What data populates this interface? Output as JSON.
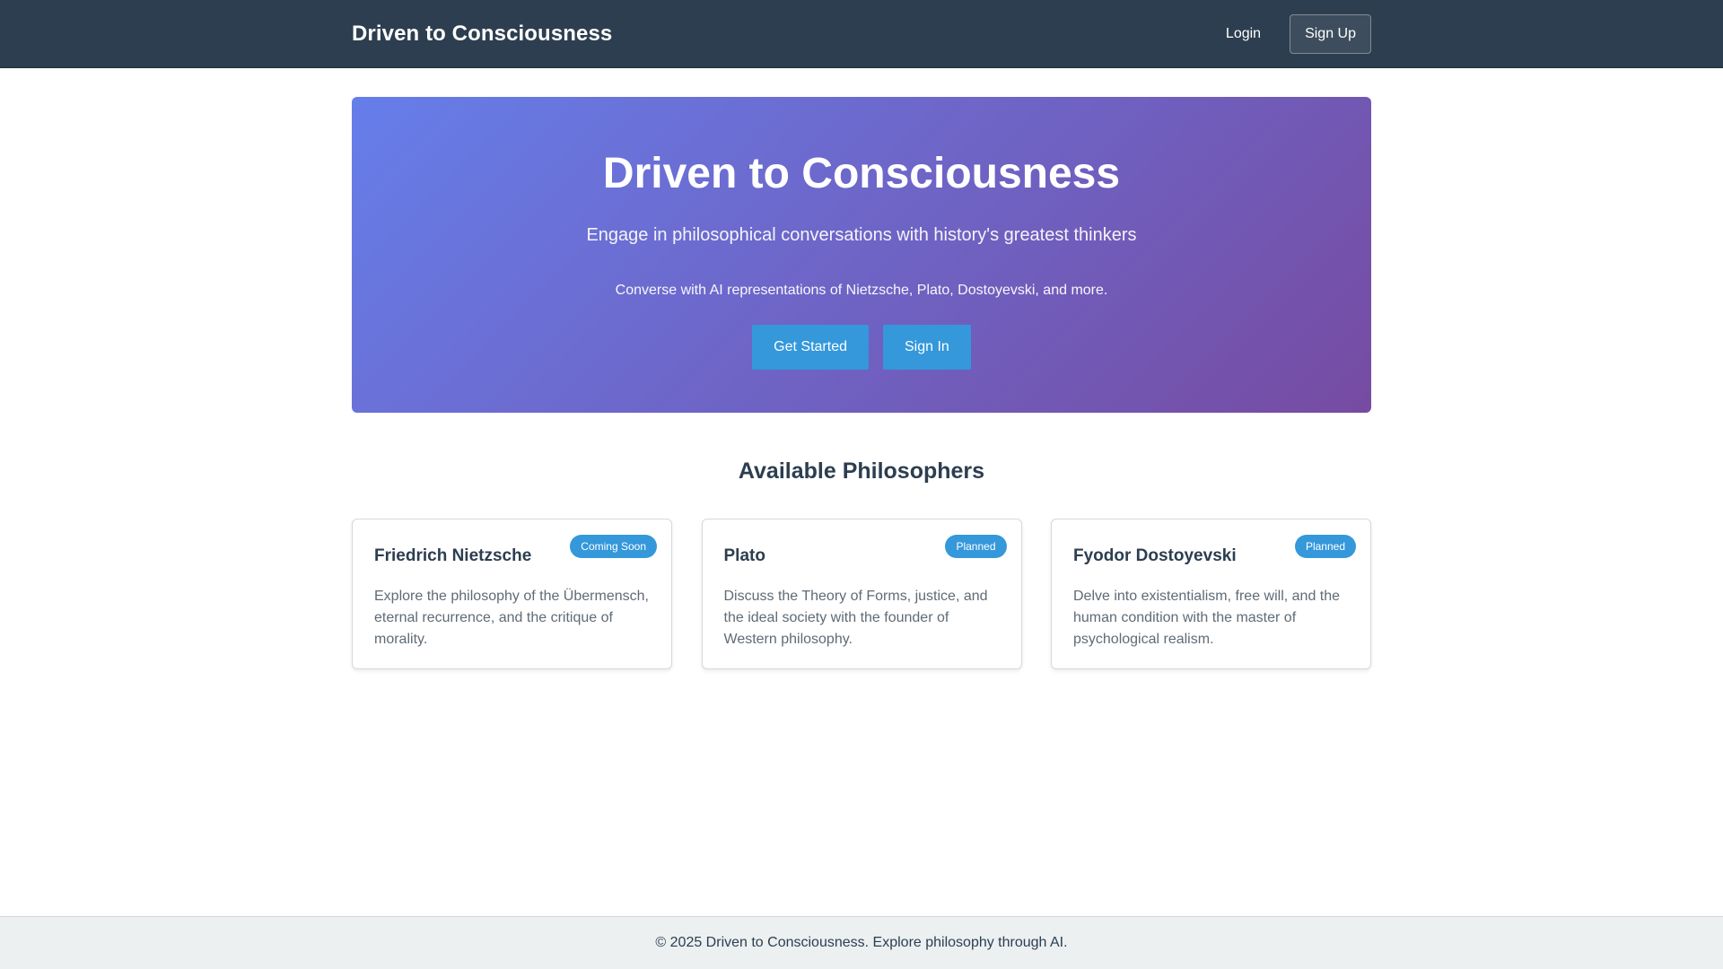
{
  "navbar": {
    "brand": "Driven to Consciousness",
    "login_label": "Login",
    "signup_label": "Sign Up"
  },
  "hero": {
    "title": "Driven to Consciousness",
    "subtitle": "Engage in philosophical conversations with history's greatest thinkers",
    "description": "Converse with AI representations of Nietzsche, Plato, Dostoyevski, and more.",
    "get_started_label": "Get Started",
    "sign_in_label": "Sign In"
  },
  "philosophers": {
    "heading": "Available Philosophers",
    "items": [
      {
        "name": "Friedrich Nietzsche",
        "status": "Coming Soon",
        "description": "Explore the philosophy of the Übermensch, eternal recurrence, and the critique of morality."
      },
      {
        "name": "Plato",
        "status": "Planned",
        "description": "Discuss the Theory of Forms, justice, and the ideal society with the founder of Western philosophy."
      },
      {
        "name": "Fyodor Dostoyevski",
        "status": "Planned",
        "description": "Delve into existentialism, free will, and the human condition with the master of psychological realism."
      }
    ]
  },
  "footer": {
    "text": "© 2025 Driven to Consciousness. Explore philosophy through AI."
  },
  "colors": {
    "navbar_bg": "#2d3e50",
    "hero_gradient_start": "#667eea",
    "hero_gradient_end": "#764ba2",
    "accent": "#3498db",
    "footer_bg": "#ecf0f1"
  }
}
